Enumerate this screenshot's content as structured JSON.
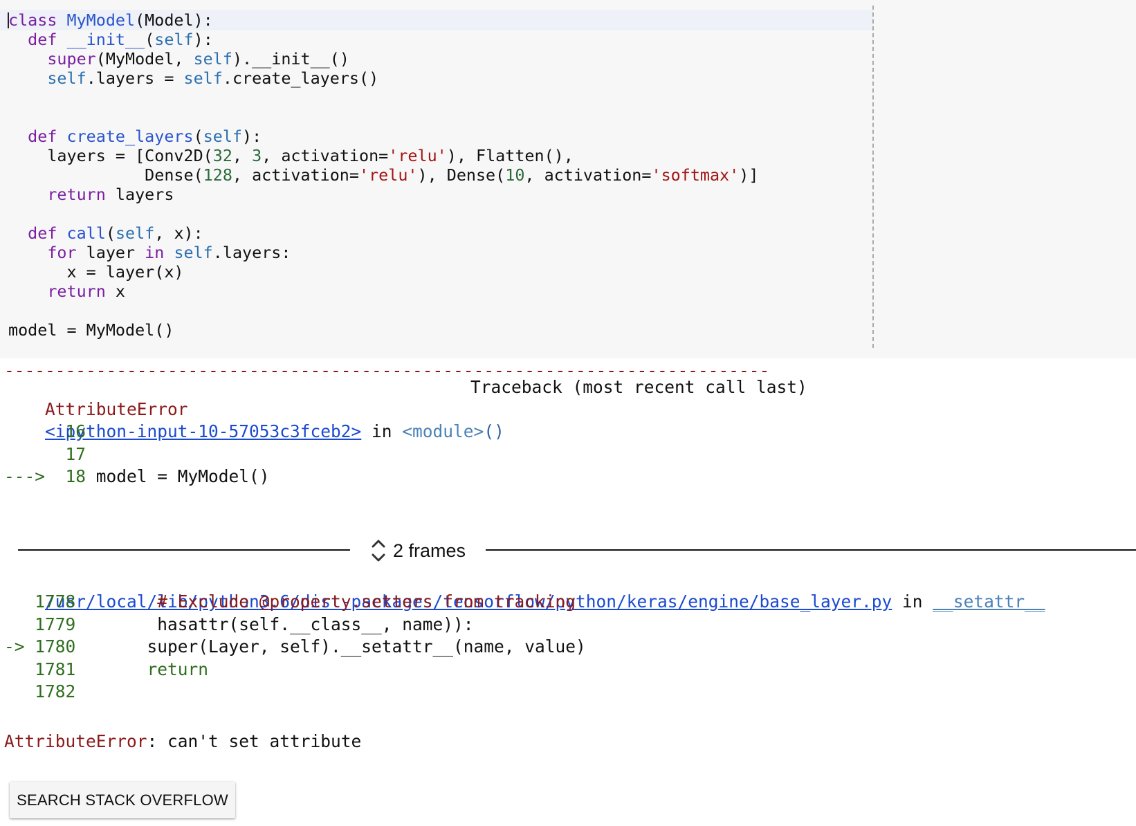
{
  "editor": {
    "lines": [
      {
        "parts": [
          [
            "kw",
            "class"
          ],
          [
            "t",
            " "
          ],
          [
            "def",
            "MyModel"
          ],
          [
            "t",
            "(Model):"
          ]
        ]
      },
      {
        "parts": [
          [
            "t",
            "  "
          ],
          [
            "kw",
            "def"
          ],
          [
            "t",
            " "
          ],
          [
            "def",
            "__init__"
          ],
          [
            "t",
            "("
          ],
          [
            "slf",
            "self"
          ],
          [
            "t",
            "):"
          ]
        ]
      },
      {
        "parts": [
          [
            "t",
            "    "
          ],
          [
            "kw",
            "super"
          ],
          [
            "t",
            "(MyModel, "
          ],
          [
            "slf",
            "self"
          ],
          [
            "t",
            ").__init__()"
          ]
        ]
      },
      {
        "parts": [
          [
            "t",
            "    "
          ],
          [
            "slf",
            "self"
          ],
          [
            "t",
            ".layers = "
          ],
          [
            "slf",
            "self"
          ],
          [
            "t",
            ".create_layers()"
          ]
        ]
      },
      {
        "parts": []
      },
      {
        "parts": []
      },
      {
        "parts": [
          [
            "t",
            "  "
          ],
          [
            "kw",
            "def"
          ],
          [
            "t",
            " "
          ],
          [
            "def",
            "create_layers"
          ],
          [
            "t",
            "("
          ],
          [
            "slf",
            "self"
          ],
          [
            "t",
            "):"
          ]
        ]
      },
      {
        "parts": [
          [
            "t",
            "    layers = [Conv2D("
          ],
          [
            "num",
            "32"
          ],
          [
            "t",
            ", "
          ],
          [
            "num",
            "3"
          ],
          [
            "t",
            ", activation="
          ],
          [
            "str",
            "'relu'"
          ],
          [
            "t",
            "), Flatten(),"
          ]
        ]
      },
      {
        "parts": [
          [
            "t",
            "              Dense("
          ],
          [
            "num",
            "128"
          ],
          [
            "t",
            ", activation="
          ],
          [
            "str",
            "'relu'"
          ],
          [
            "t",
            "), Dense("
          ],
          [
            "num",
            "10"
          ],
          [
            "t",
            ", activation="
          ],
          [
            "str",
            "'softmax'"
          ],
          [
            "t",
            ")]"
          ]
        ]
      },
      {
        "parts": [
          [
            "t",
            "    "
          ],
          [
            "kw",
            "return"
          ],
          [
            "t",
            " layers"
          ]
        ]
      },
      {
        "parts": []
      },
      {
        "parts": [
          [
            "t",
            "  "
          ],
          [
            "kw",
            "def"
          ],
          [
            "t",
            " "
          ],
          [
            "def",
            "call"
          ],
          [
            "t",
            "("
          ],
          [
            "slf",
            "self"
          ],
          [
            "t",
            ", x):"
          ]
        ]
      },
      {
        "parts": [
          [
            "t",
            "    "
          ],
          [
            "kw",
            "for"
          ],
          [
            "t",
            " layer "
          ],
          [
            "kw",
            "in"
          ],
          [
            "t",
            " "
          ],
          [
            "slf",
            "self"
          ],
          [
            "t",
            ".layers:"
          ]
        ]
      },
      {
        "parts": [
          [
            "t",
            "      x = layer(x)"
          ]
        ]
      },
      {
        "parts": [
          [
            "t",
            "    "
          ],
          [
            "kw",
            "return"
          ],
          [
            "t",
            " x"
          ]
        ]
      },
      {
        "parts": []
      },
      {
        "parts": [
          [
            "t",
            "model = MyModel()"
          ]
        ]
      }
    ]
  },
  "traceback": {
    "separator": "---------------------------------------------------------------------------",
    "error_name": "AttributeError",
    "header_right": "Traceback (most recent call last)",
    "frame1": {
      "link": "<ipython-input-10-57053c3fceb2>",
      "in_text": " in ",
      "module": "<module>",
      "parens": "()"
    },
    "frame1_lines": [
      {
        "arrow": "",
        "num": "16",
        "code": ""
      },
      {
        "arrow": "",
        "num": "17",
        "code": ""
      },
      {
        "arrow": "---> ",
        "num": "18",
        "code": "model = MyModel()"
      }
    ],
    "frames_label": "2 frames",
    "frame2": {
      "link": "/usr/local/lib/python3.6/dist-packages/tensorflow/python/keras/engine/base_layer.py",
      "in_text": " in ",
      "func": "__setattr__"
    },
    "frame2_lines": [
      {
        "arrow": "",
        "num": "1778",
        "code": "# Exclude @property.setters from tracking"
      },
      {
        "arrow": "",
        "num": "1779",
        "code": "hasattr(self.__class__, name)):"
      },
      {
        "arrow": "-> ",
        "num": "1780",
        "code": "super(Layer, self).__setattr__(name, value)"
      },
      {
        "arrow": "",
        "num": "1781",
        "code": "return"
      },
      {
        "arrow": "",
        "num": "1782",
        "code": ""
      }
    ],
    "final_error": "AttributeError",
    "final_message": ": can't set attribute"
  },
  "actions": {
    "search_label": "SEARCH STACK OVERFLOW"
  },
  "colors": {
    "keyword": "#7a1fa2",
    "definition": "#2a55cc",
    "string": "#a31515",
    "number": "#2a6a3a",
    "error": "#8b1a1a",
    "link": "#1a4ad0"
  }
}
